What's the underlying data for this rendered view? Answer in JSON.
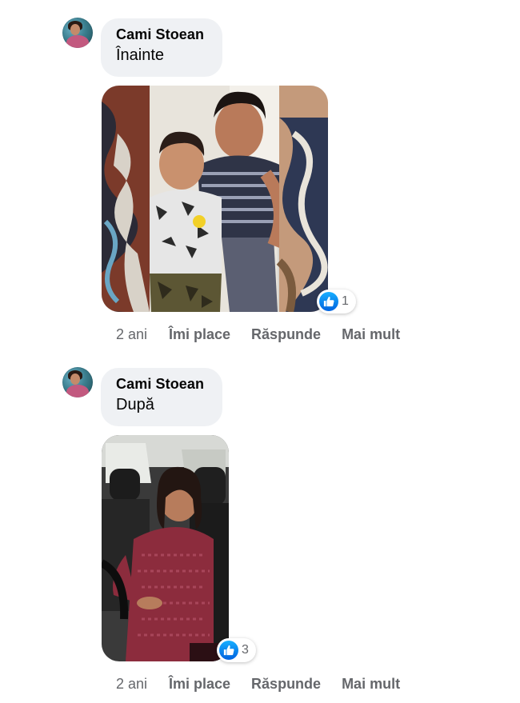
{
  "comments": [
    {
      "author": "Cami Stoean",
      "text": "Înainte",
      "reaction_count": "1",
      "time": "2 ani",
      "like_label": "Îmi place",
      "reply_label": "Răspunde",
      "more_label": "Mai mult"
    },
    {
      "author": "Cami Stoean",
      "text": "După",
      "reaction_count": "3",
      "time": "2 ani",
      "like_label": "Îmi place",
      "reply_label": "Răspunde",
      "more_label": "Mai mult"
    }
  ],
  "icons": {
    "reaction": "like-icon",
    "avatar": "profile-photo"
  },
  "colors": {
    "bubble": "#eff1f4",
    "secondary_text": "#65676b",
    "like_blue": "#1877f2"
  }
}
